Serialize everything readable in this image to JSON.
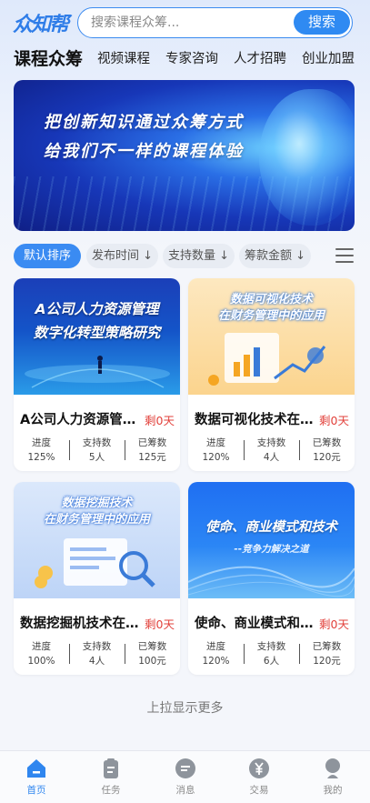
{
  "app": {
    "logo_text": "众知帮"
  },
  "search": {
    "placeholder": "搜索课程众筹...",
    "button_label": "搜索"
  },
  "nav": {
    "items": [
      {
        "label": "课程众筹",
        "active": true
      },
      {
        "label": "视频课程",
        "active": false
      },
      {
        "label": "专家咨询",
        "active": false
      },
      {
        "label": "人才招聘",
        "active": false
      },
      {
        "label": "创业加盟",
        "active": false
      }
    ]
  },
  "banner": {
    "line1": "把创新知识通过众筹方式",
    "line2": "给我们不一样的课程体验"
  },
  "sort": {
    "options": [
      {
        "label": "默认排序",
        "active": true
      },
      {
        "label": "发布时间 ↓",
        "active": false
      },
      {
        "label": "支持数量 ↓",
        "active": false
      },
      {
        "label": "筹款金额 ↓",
        "active": false
      }
    ],
    "menu_icon": "menu-icon"
  },
  "stat_labels": {
    "progress": "进度",
    "supporters": "支持数",
    "raised": "已筹数"
  },
  "cards": [
    {
      "image_title_1": "A公司人力资源管理",
      "image_title_2": "数字化转型策略研究",
      "title": "A公司人力资源管理数字化转型策略研究",
      "remaining": "剩0天",
      "progress": "125%",
      "supporters": "5人",
      "raised": "125元"
    },
    {
      "image_title_1": "数据可视化技术",
      "image_title_2": "在财务管理中的应用",
      "title": "数据可视化技术在财务管理中的应用",
      "remaining": "剩0天",
      "progress": "120%",
      "supporters": "4人",
      "raised": "120元"
    },
    {
      "image_title_1": "数据挖掘技术",
      "image_title_2": "在财务管理中的应用",
      "title": "数据挖掘机技术在财务管理中的应用",
      "remaining": "剩0天",
      "progress": "100%",
      "supporters": "4人",
      "raised": "100元"
    },
    {
      "image_title_1": "使命、商业模式和技术",
      "image_title_2": "--竞争力解决之道",
      "title": "使命、商业模式和技术",
      "remaining": "剩0天",
      "progress": "120%",
      "supporters": "6人",
      "raised": "120元"
    }
  ],
  "load_more": "上拉显示更多",
  "tabbar": {
    "items": [
      {
        "label": "首页",
        "icon": "home-icon",
        "active": true
      },
      {
        "label": "任务",
        "icon": "task-icon",
        "active": false
      },
      {
        "label": "消息",
        "icon": "message-icon",
        "active": false
      },
      {
        "label": "交易",
        "icon": "yen-icon",
        "active": false
      },
      {
        "label": "我的",
        "icon": "profile-icon",
        "active": false
      }
    ]
  },
  "colors": {
    "accent": "#2f86ef",
    "remaining_red": "#e2413b",
    "logo": "#2f7de8"
  }
}
